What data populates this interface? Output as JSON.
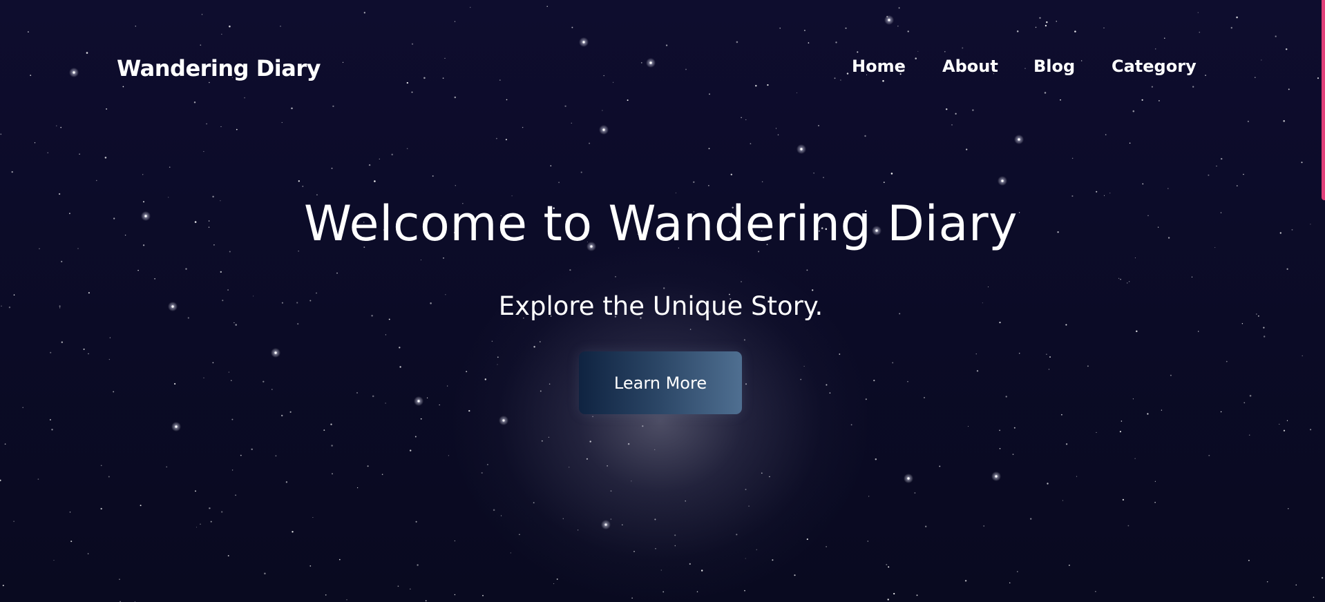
{
  "brand": {
    "name": "Wandering Diary"
  },
  "nav": {
    "items": [
      {
        "label": "Home"
      },
      {
        "label": "About"
      },
      {
        "label": "Blog"
      },
      {
        "label": "Category"
      }
    ]
  },
  "hero": {
    "title": "Welcome to Wandering Diary",
    "subtitle": "Explore the Unique Story.",
    "cta_label": "Learn More"
  },
  "colors": {
    "background": "#0d0c2b",
    "text": "#ffffff",
    "button_start": "#0f2341",
    "button_end": "#4f6f91",
    "scroll_accent": "#e0407a"
  }
}
